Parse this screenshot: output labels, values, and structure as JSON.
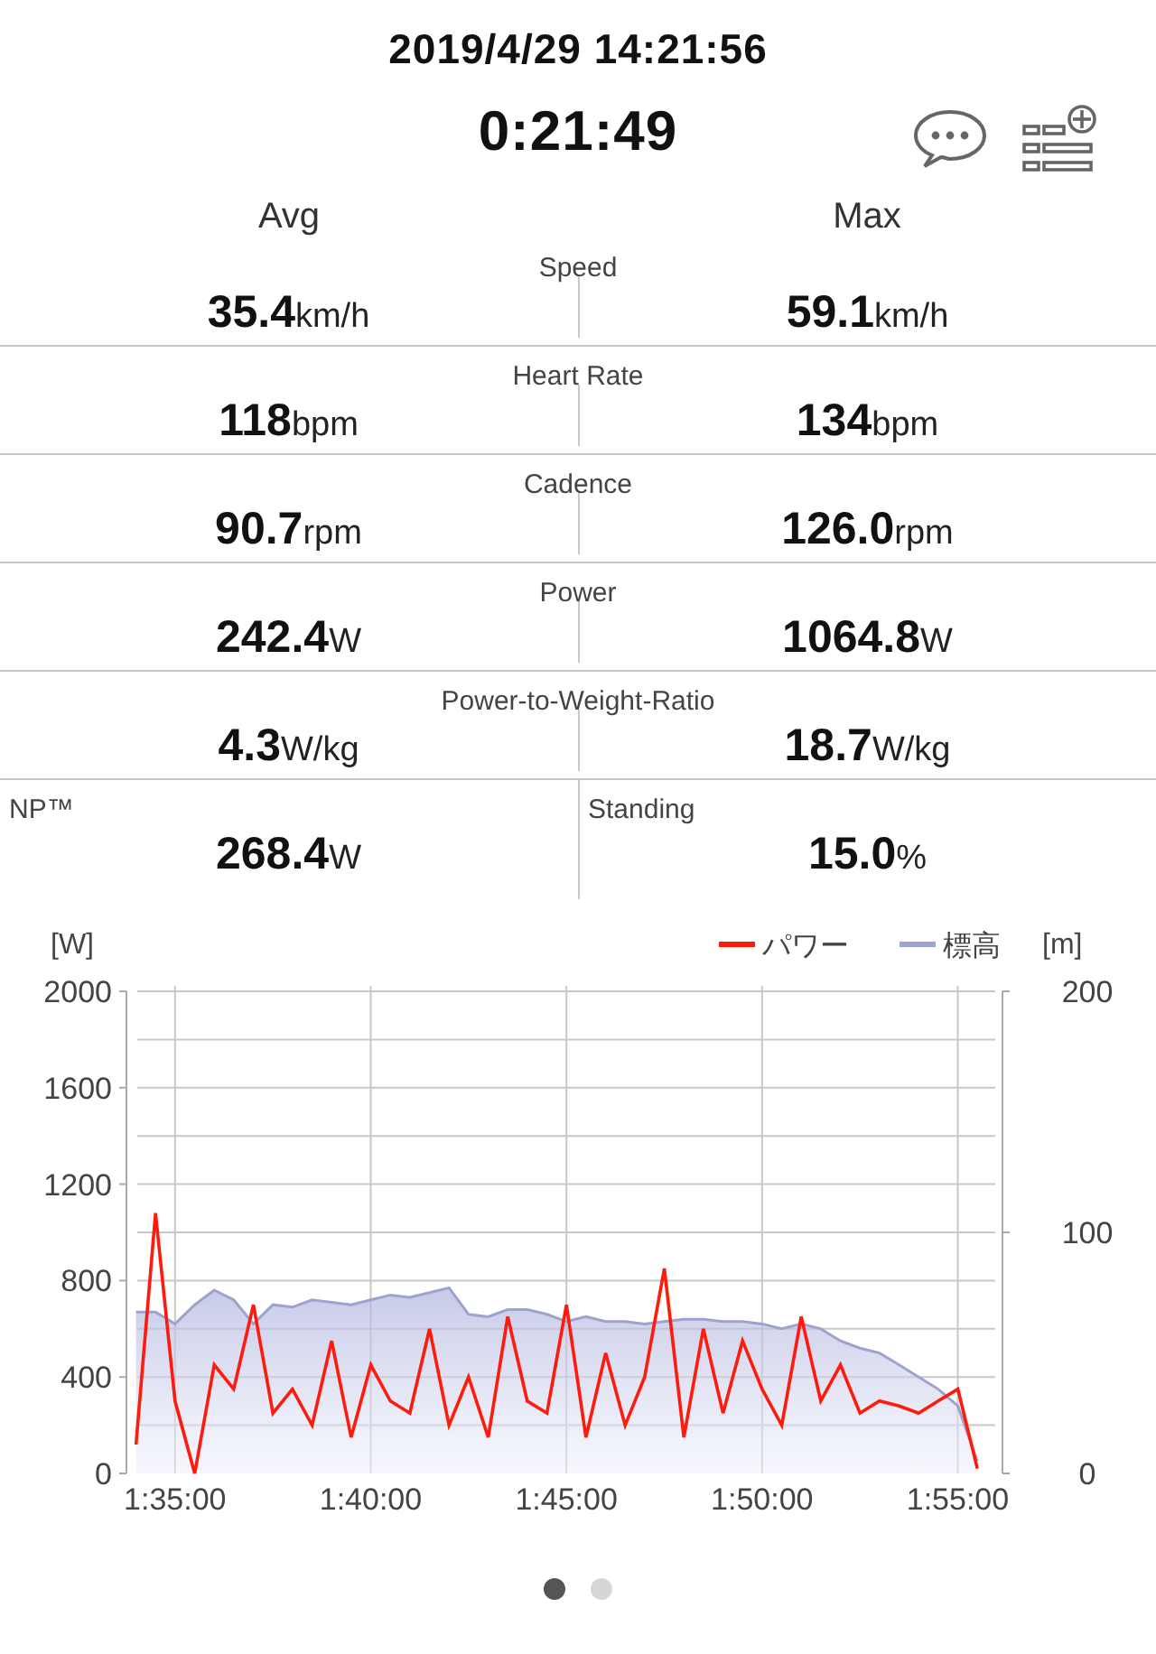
{
  "header": {
    "datetime": "2019/4/29 14:21:56",
    "duration": "0:21:49"
  },
  "columns": [
    "Avg",
    "Max"
  ],
  "stats": [
    {
      "kind": "paired",
      "label": "Speed",
      "avg": {
        "value": "35.4",
        "unit": "km/h"
      },
      "max": {
        "value": "59.1",
        "unit": "km/h"
      }
    },
    {
      "kind": "paired",
      "label": "Heart Rate",
      "avg": {
        "value": "118",
        "unit": "bpm"
      },
      "max": {
        "value": "134",
        "unit": "bpm"
      }
    },
    {
      "kind": "paired",
      "label": "Cadence",
      "avg": {
        "value": "90.7",
        "unit": "rpm"
      },
      "max": {
        "value": "126.0",
        "unit": "rpm"
      }
    },
    {
      "kind": "paired",
      "label": "Power",
      "avg": {
        "value": "242.4",
        "unit": "W"
      },
      "max": {
        "value": "1064.8",
        "unit": "W"
      }
    },
    {
      "kind": "paired",
      "label": "Power-to-Weight-Ratio",
      "avg": {
        "value": "4.3",
        "unit": "W/kg"
      },
      "max": {
        "value": "18.7",
        "unit": "W/kg"
      }
    },
    {
      "kind": "split",
      "cells": [
        {
          "label": "NP™",
          "value": "268.4",
          "unit": "W"
        },
        {
          "label": "Standing",
          "value": "15.0",
          "unit": "%"
        }
      ]
    }
  ],
  "chart": {
    "ylabel": "[W]",
    "y2label": "[m]",
    "chart_data": {
      "type": "line",
      "x": [
        5640,
        5670,
        5700,
        5730,
        5760,
        5790,
        5820,
        5850,
        5880,
        5910,
        5940,
        5970,
        6000,
        6030,
        6060,
        6090,
        6120,
        6150,
        6180,
        6210,
        6240,
        6270,
        6300,
        6330,
        6360,
        6390,
        6420,
        6450,
        6480,
        6510,
        6540,
        6570,
        6600,
        6630,
        6660,
        6690,
        6720,
        6750,
        6780,
        6810,
        6840,
        6870,
        6900,
        6930
      ],
      "series": [
        {
          "name": "パワー",
          "color": "#ff1a0d",
          "values": [
            120,
            1080,
            300,
            0,
            450,
            350,
            700,
            250,
            350,
            200,
            550,
            150,
            450,
            300,
            250,
            600,
            200,
            400,
            150,
            650,
            300,
            250,
            700,
            150,
            500,
            200,
            400,
            850,
            150,
            600,
            250,
            550,
            350,
            200,
            650,
            300,
            450,
            250,
            300,
            280,
            250,
            300,
            350,
            20
          ]
        },
        {
          "name": "標高",
          "color": "#9da3cc",
          "axis": "y2",
          "values": [
            67,
            67,
            62,
            70,
            76,
            72,
            62,
            70,
            69,
            72,
            71,
            70,
            72,
            74,
            73,
            75,
            77,
            66,
            65,
            68,
            68,
            66,
            63,
            65,
            63,
            63,
            62,
            63,
            64,
            64,
            63,
            63,
            62,
            60,
            62,
            60,
            55,
            52,
            50,
            45,
            40,
            35,
            28,
            5
          ]
        }
      ],
      "xlim": [
        5631,
        6963
      ],
      "ylim": [
        0,
        2000
      ],
      "y2lim": [
        0,
        200
      ],
      "xticks": [
        {
          "value": 5700,
          "label": "1:35:00"
        },
        {
          "value": 6000,
          "label": "1:40:00"
        },
        {
          "value": 6300,
          "label": "1:45:00"
        },
        {
          "value": 6600,
          "label": "1:50:00"
        },
        {
          "value": 6900,
          "label": "1:55:00"
        }
      ],
      "grid": true,
      "legend": true,
      "yticks": [
        0,
        400,
        800,
        1200,
        1600,
        2000
      ],
      "y2ticks": [
        0,
        100,
        200
      ]
    }
  },
  "pager": [
    {
      "selected": true
    },
    {
      "selected": false
    }
  ]
}
